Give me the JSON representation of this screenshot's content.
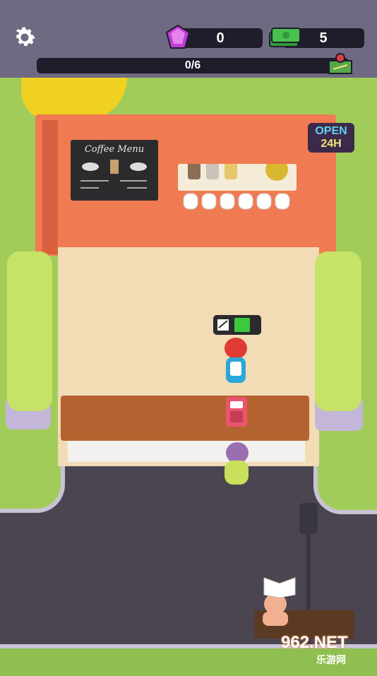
{
  "hud": {
    "gems": "0",
    "cash": "5",
    "progress_text": "0/6",
    "progress_fraction": 0.0
  },
  "icons": {
    "settings": "gear-icon",
    "gem": "gem-icon",
    "cash": "cash-stack-icon",
    "map": "map-icon"
  },
  "scene": {
    "menu_board_title": "Coffee Menu",
    "open_sign_line1": "OPEN",
    "open_sign_line2": "24H",
    "worker_energy": 0.5
  },
  "watermark": {
    "brand": "962.NET",
    "sub": "乐游网"
  },
  "colors": {
    "hud_bar": "#6e6a82",
    "wall": "#f07a52",
    "counter": "#b4622f",
    "grass": "#a2cc5a"
  }
}
